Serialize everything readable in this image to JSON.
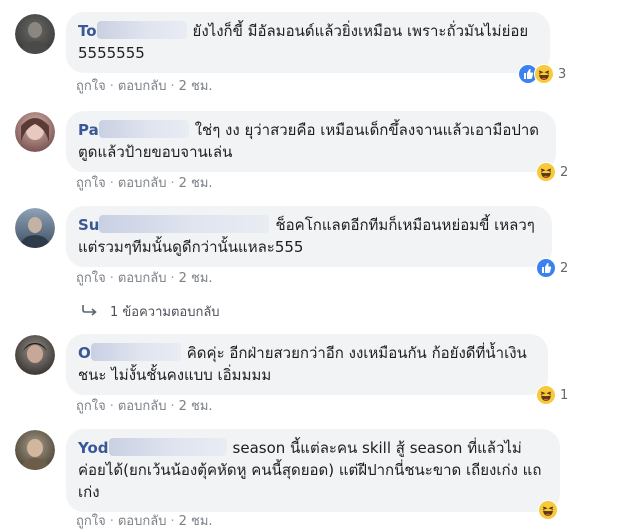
{
  "comments": [
    {
      "author": "To",
      "text": "ยังไงก็ขี้ มีอัลมอนด์แล้วยิ่งเหมือน เพราะถั่วมันไม่ย่อย 5555555",
      "like_label": "ถูกใจ",
      "reply_label": "ตอบกลับ",
      "time": "2 ชม.",
      "reaction_count": "3",
      "reactions": [
        "like-icon",
        "haha-icon"
      ]
    },
    {
      "author": "Pa",
      "text": "ใช่ๆ งง ยุว่าสวยคือ เหมือนเด็กขึ้ลงจานแล้วเอามือปาดตูดแล้วป้ายขอบจานเล่น",
      "like_label": "ถูกใจ",
      "reply_label": "ตอบกลับ",
      "time": "2 ชม.",
      "reaction_count": "2",
      "reactions": [
        "haha-icon"
      ]
    },
    {
      "author": "Su",
      "text": "ช็อคโกแลตอีกทีมก็เหมือนหย่อมขี้ เหลวๆแต่รวมๆทีมนั้นดูดีกว่านั้นแหละ555",
      "like_label": "ถูกใจ",
      "reply_label": "ตอบกลับ",
      "time": "2 ชม.",
      "reaction_count": "2",
      "reactions": [
        "like-icon"
      ]
    },
    {
      "author": "O",
      "text": "คิดคุ่ะ อีกฝ่ายสวยกว่าอีก งงเหมือนกัน ก้อยังดีที่น้ำเงินชนะ ไม่งั้นชั้นคงแบบ เอิ่มมมม",
      "like_label": "ถูกใจ",
      "reply_label": "ตอบกลับ",
      "time": "2 ชม.",
      "reaction_count": "1",
      "reactions": [
        "haha-icon"
      ]
    },
    {
      "author": "Yod",
      "text": "season นี้แต่ละคน skill สู้ season ที่แล้วไม่ค่อยได้(ยกเว้นน้องตุ้คหัดหู คนนี้สุดยอด) แต่ฝีปากนี่ชนะขาด เถียงเก่ง แถเก่ง",
      "like_label": "ถูกใจ",
      "reply_label": "ตอบกลับ",
      "time": "2 ชม.",
      "reaction_count": "",
      "reactions": [
        "haha-icon"
      ]
    }
  ],
  "reply_thread": {
    "label": "1 ข้อความตอบกลับ",
    "icon": "reply-arrow-icon"
  },
  "colors": {
    "bubble": "#f2f3f5",
    "author": "#385898",
    "meta": "#7c8189",
    "like": "#3b82f0",
    "haha": "#f7c93b"
  }
}
